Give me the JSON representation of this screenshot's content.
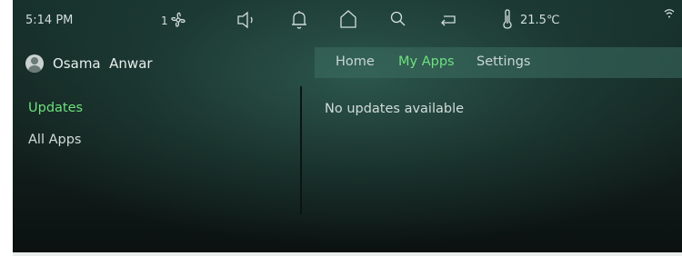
{
  "status": {
    "time": "5:14 PM",
    "fan_speed": "1",
    "temperature": "21.5℃"
  },
  "icons": {
    "fan": "fan-icon",
    "volume": "volume-icon",
    "notifications": "bell-icon",
    "home": "home-icon",
    "search": "search-icon",
    "back": "back-icon",
    "thermometer": "thermometer-icon",
    "wifi": "wifi-icon"
  },
  "user": {
    "name": "Osama  Anwar"
  },
  "tabs": [
    {
      "label": "Home"
    },
    {
      "label": "My Apps"
    },
    {
      "label": "Settings"
    }
  ],
  "sidebar": {
    "items": [
      {
        "label": "Updates"
      },
      {
        "label": "All Apps"
      }
    ]
  },
  "main": {
    "message": "No updates available"
  },
  "colors": {
    "accent": "#6ee07e",
    "text": "#d2dcd9"
  }
}
